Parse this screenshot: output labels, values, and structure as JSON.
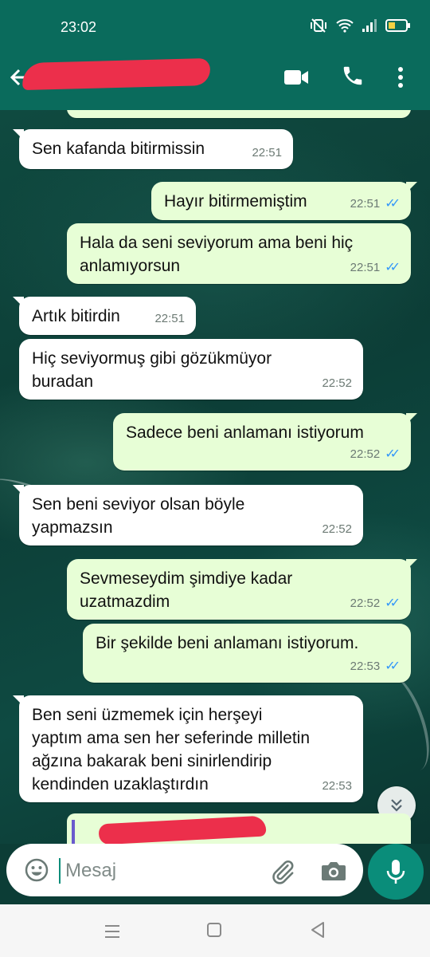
{
  "status_bar": {
    "time": "23:02"
  },
  "header": {
    "contact_name": ""
  },
  "messages": [
    {
      "direction": "in",
      "text_lines": [
        "Sen kafanda bitirmissin"
      ],
      "time": "22:51"
    },
    {
      "direction": "out",
      "text_lines": [
        "Hayır bitirmemiştim"
      ],
      "time": "22:51",
      "status": "read"
    },
    {
      "direction": "out",
      "text_lines": [
        "Hala da seni seviyorum ama beni hiç",
        "anlamıyorsun"
      ],
      "time": "22:51",
      "status": "read"
    },
    {
      "direction": "in",
      "text_lines": [
        "Artık bitirdin"
      ],
      "time": "22:51"
    },
    {
      "direction": "in",
      "text_lines": [
        "Hiç seviyormuş gibi gözükmüyor",
        "buradan"
      ],
      "time": "22:52"
    },
    {
      "direction": "out",
      "text_lines": [
        "Sadece beni anlamanı istiyorum"
      ],
      "time": "22:52",
      "status": "read"
    },
    {
      "direction": "in",
      "text_lines": [
        "Sen beni seviyor olsan böyle",
        "yapmazsın"
      ],
      "time": "22:52"
    },
    {
      "direction": "out",
      "text_lines": [
        "Sevmeseydim şimdiye kadar",
        "uzatmazdim"
      ],
      "time": "22:52",
      "status": "read"
    },
    {
      "direction": "out",
      "text_lines": [
        "Bir şekilde beni anlamanı istiyorum."
      ],
      "time": "22:53",
      "status": "read"
    },
    {
      "direction": "in",
      "text_lines": [
        "Ben seni üzmemek için herşeyi",
        "yaptım ama sen her seferinde milletin",
        "ağzına bakarak beni sinirlendirip",
        "kendinden uzaklaştırdın"
      ],
      "time": "22:53"
    }
  ],
  "composer": {
    "placeholder": "Mesaj"
  },
  "colors": {
    "header": "#0a6b5c",
    "outgoing_bubble": "#e7fed6",
    "incoming_bubble": "#ffffff",
    "read_ticks": "#3497f9",
    "accent": "#0a8d7a"
  }
}
